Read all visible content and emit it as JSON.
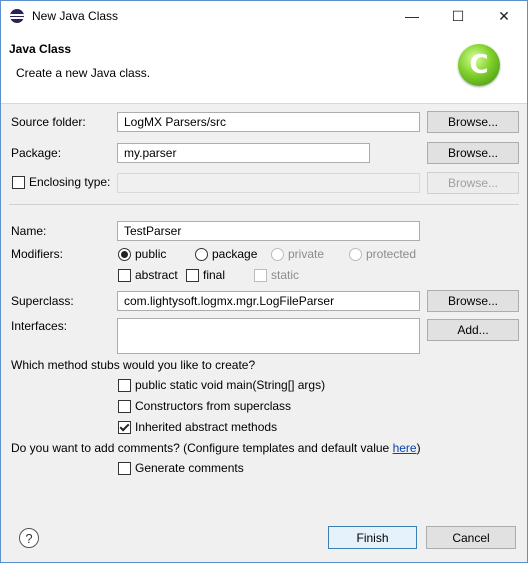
{
  "window": {
    "title": "New Java Class",
    "minimize_glyph": "—",
    "maximize_glyph": "☐",
    "close_glyph": "✕"
  },
  "banner": {
    "title": "Java Class",
    "description": "Create a new Java class.",
    "logo_letter": "C"
  },
  "source_folder": {
    "label": "Source folder:",
    "value": "LogMX Parsers/src",
    "browse_label": "Browse..."
  },
  "package": {
    "label": "Package:",
    "value": "my.parser",
    "browse_label": "Browse..."
  },
  "enclosing_type": {
    "label": "Enclosing type:",
    "value": "",
    "browse_label": "Browse...",
    "checked": false
  },
  "name": {
    "label": "Name:",
    "value": "TestParser"
  },
  "modifiers": {
    "label": "Modifiers:",
    "radios": [
      {
        "label": "public",
        "checked": true,
        "enabled": true
      },
      {
        "label": "package",
        "checked": false,
        "enabled": true
      },
      {
        "label": "private",
        "checked": false,
        "enabled": false
      },
      {
        "label": "protected",
        "checked": false,
        "enabled": false
      }
    ],
    "checks": [
      {
        "label": "abstract",
        "checked": false,
        "enabled": true
      },
      {
        "label": "final",
        "checked": false,
        "enabled": true
      },
      {
        "label": "static",
        "checked": false,
        "enabled": false
      }
    ]
  },
  "superclass": {
    "label": "Superclass:",
    "value": "com.lightysoft.logmx.mgr.LogFileParser",
    "browse_label": "Browse..."
  },
  "interfaces": {
    "label": "Interfaces:",
    "add_label": "Add..."
  },
  "stubs": {
    "question": "Which method stubs would you like to create?",
    "options": [
      {
        "label": "public static void main(String[] args)",
        "checked": false
      },
      {
        "label": "Constructors from superclass",
        "checked": false
      },
      {
        "label": "Inherited abstract methods",
        "checked": true
      }
    ]
  },
  "comments": {
    "question_prefix": "Do you want to add comments? (Configure templates and default value ",
    "link_text": "here",
    "question_suffix": ")",
    "option_label": "Generate comments",
    "option_checked": false
  },
  "buttons": {
    "help_glyph": "?",
    "finish": "Finish",
    "cancel": "Cancel"
  },
  "colors": {
    "accent": "#3c7fb1",
    "link": "#0645ad",
    "logo_green": "#7fcf2a"
  }
}
